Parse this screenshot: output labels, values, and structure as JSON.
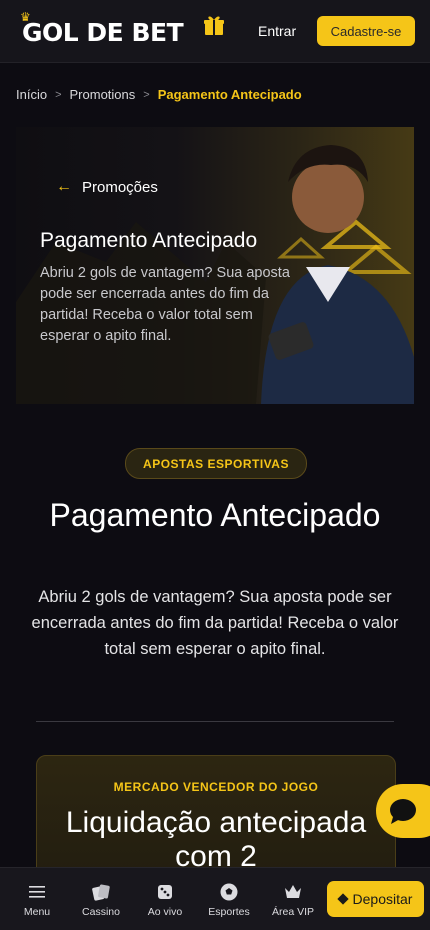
{
  "header": {
    "logo_text": "GOL DE BET",
    "gift_icon": "gift-icon",
    "enter_label": "Entrar",
    "signup_label": "Cadastre-se"
  },
  "breadcrumb": {
    "items": [
      "Início",
      "Promotions",
      "Pagamento Antecipado"
    ]
  },
  "hero": {
    "back_label": "Promoções",
    "title": "Pagamento Antecipado",
    "description": "Abriu 2 gols de vantagem? Sua aposta pode ser encerrada antes do fim da partida! Receba o valor total sem esperar o apito final."
  },
  "main": {
    "badge": "APOSTAS ESPORTIVAS",
    "title": "Pagamento Antecipado",
    "description": "Abriu 2 gols de vantagem? Sua aposta pode ser encerrada antes do fim da partida! Receba o valor total sem esperar o apito final."
  },
  "card": {
    "label": "MERCADO VENCEDOR DO JOGO",
    "title": "Liquidação antecipada com 2"
  },
  "bottom_nav": {
    "items": [
      "Menu",
      "Cassino",
      "Ao vivo",
      "Esportes",
      "Área VIP"
    ],
    "deposit_label": "Depositar"
  },
  "colors": {
    "accent": "#f5c518",
    "background": "#0d0c12"
  }
}
